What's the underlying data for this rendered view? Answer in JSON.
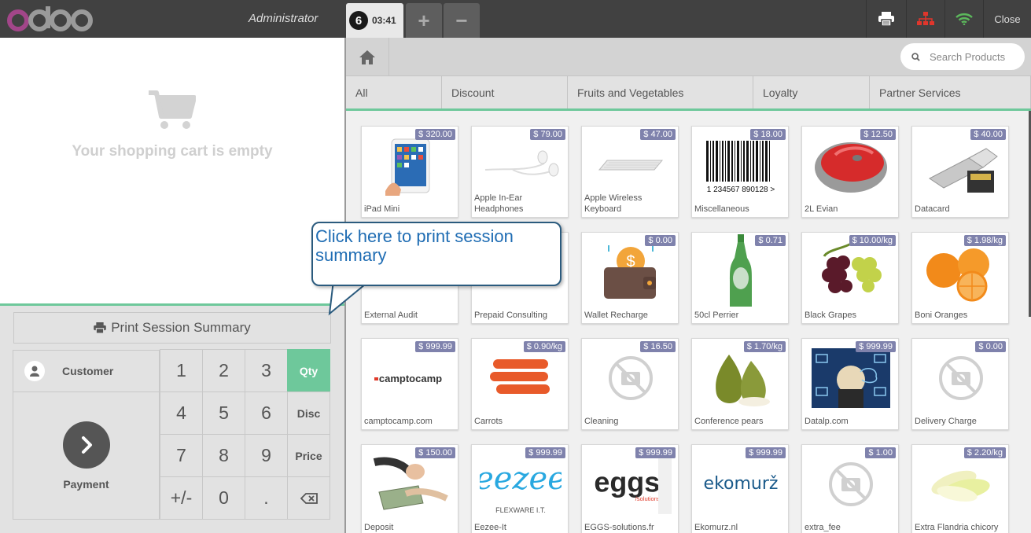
{
  "app": {
    "logo_text": "odoo",
    "user": "Administrator"
  },
  "order_tabs": [
    {
      "number": "6",
      "time": "03:41"
    }
  ],
  "tab_controls": {
    "add": "+",
    "remove": "−"
  },
  "header_buttons": {
    "print_icon": "printer-icon",
    "proxy_icon": "network-icon",
    "wifi_icon": "wifi-icon",
    "close_label": "Close"
  },
  "cart": {
    "empty_message": "Your shopping cart is empty"
  },
  "controls": {
    "print_summary_label": "Print Session Summary",
    "customer_label": "Customer",
    "payment_label": "Payment"
  },
  "numpad": [
    {
      "label": "1",
      "type": "digit"
    },
    {
      "label": "2",
      "type": "digit"
    },
    {
      "label": "3",
      "type": "digit"
    },
    {
      "label": "Qty",
      "type": "mode",
      "active": true
    },
    {
      "label": "4",
      "type": "digit"
    },
    {
      "label": "5",
      "type": "digit"
    },
    {
      "label": "6",
      "type": "digit"
    },
    {
      "label": "Disc",
      "type": "mode"
    },
    {
      "label": "7",
      "type": "digit"
    },
    {
      "label": "8",
      "type": "digit"
    },
    {
      "label": "9",
      "type": "digit"
    },
    {
      "label": "Price",
      "type": "mode"
    },
    {
      "label": "+/-",
      "type": "digit"
    },
    {
      "label": "0",
      "type": "digit"
    },
    {
      "label": ".",
      "type": "digit"
    },
    {
      "label": "⌫",
      "type": "backspace"
    }
  ],
  "search": {
    "placeholder": "Search Products"
  },
  "categories": [
    "All",
    "Discount",
    "Fruits and Vegetables",
    "Loyalty",
    "Partner Services"
  ],
  "products": [
    {
      "name": "iPad Mini",
      "price": "$ 320.00",
      "img": "ipad"
    },
    {
      "name": "Apple In-Ear Headphones",
      "price": "$ 79.00",
      "img": "headphones"
    },
    {
      "name": "Apple Wireless Keyboard",
      "price": "$ 47.00",
      "img": "keyboard"
    },
    {
      "name": "Miscellaneous",
      "price": "$ 18.00",
      "img": "barcode"
    },
    {
      "name": "2L Evian",
      "price": "$ 12.50",
      "img": "mouse"
    },
    {
      "name": "Datacard",
      "price": "$ 40.00",
      "img": "usb"
    },
    {
      "name": "External Audit",
      "price": "",
      "img": "none"
    },
    {
      "name": "Prepaid Consulting",
      "price": "",
      "img": "none"
    },
    {
      "name": "Wallet Recharge",
      "price": "$ 0.00",
      "img": "wallet"
    },
    {
      "name": "50cl Perrier",
      "price": "$ 0.71",
      "img": "bottle"
    },
    {
      "name": "Black Grapes",
      "price": "$ 10.00/kg",
      "img": "grapes"
    },
    {
      "name": "Boni Oranges",
      "price": "$ 1.98/kg",
      "img": "oranges"
    },
    {
      "name": "camptocamp.com",
      "price": "$ 999.99",
      "img": "camptocamp"
    },
    {
      "name": "Carrots",
      "price": "$ 0.90/kg",
      "img": "carrots"
    },
    {
      "name": "Cleaning",
      "price": "$ 16.50",
      "img": "noimage"
    },
    {
      "name": "Conference pears",
      "price": "$ 1.70/kg",
      "img": "pears"
    },
    {
      "name": "Datalp.com",
      "price": "$ 999.99",
      "img": "datalp"
    },
    {
      "name": "Delivery Charge",
      "price": "$ 0.00",
      "img": "noimage"
    },
    {
      "name": "Deposit",
      "price": "$ 150.00",
      "img": "money"
    },
    {
      "name": "Eezee-It",
      "price": "$ 999.99",
      "img": "eezee"
    },
    {
      "name": "EGGS-solutions.fr",
      "price": "$ 999.99",
      "img": "eggs"
    },
    {
      "name": "Ekomurz.nl",
      "price": "$ 999.99",
      "img": "ekomurz"
    },
    {
      "name": "extra_fee",
      "price": "$ 1.00",
      "img": "noimage"
    },
    {
      "name": "Extra Flandria chicory",
      "price": "$ 2.20/kg",
      "img": "chicory"
    }
  ],
  "logo_texts": {
    "camptocamp": "camptocamp",
    "eezee_top": "eezee",
    "eezee_sub": "FLEXWARE I.T.",
    "eggs": "eggs",
    "eggs_sub": "/solutions",
    "ekomurz": "ekomurž"
  },
  "barcode_digits": "1 234567 890128 >",
  "callout": {
    "text": "Click here to print session summary"
  },
  "colors": {
    "accent": "#6ec89b",
    "price_badge": "#7f82ac",
    "topbar": "#414141",
    "callout_text": "#1e6cb3"
  }
}
